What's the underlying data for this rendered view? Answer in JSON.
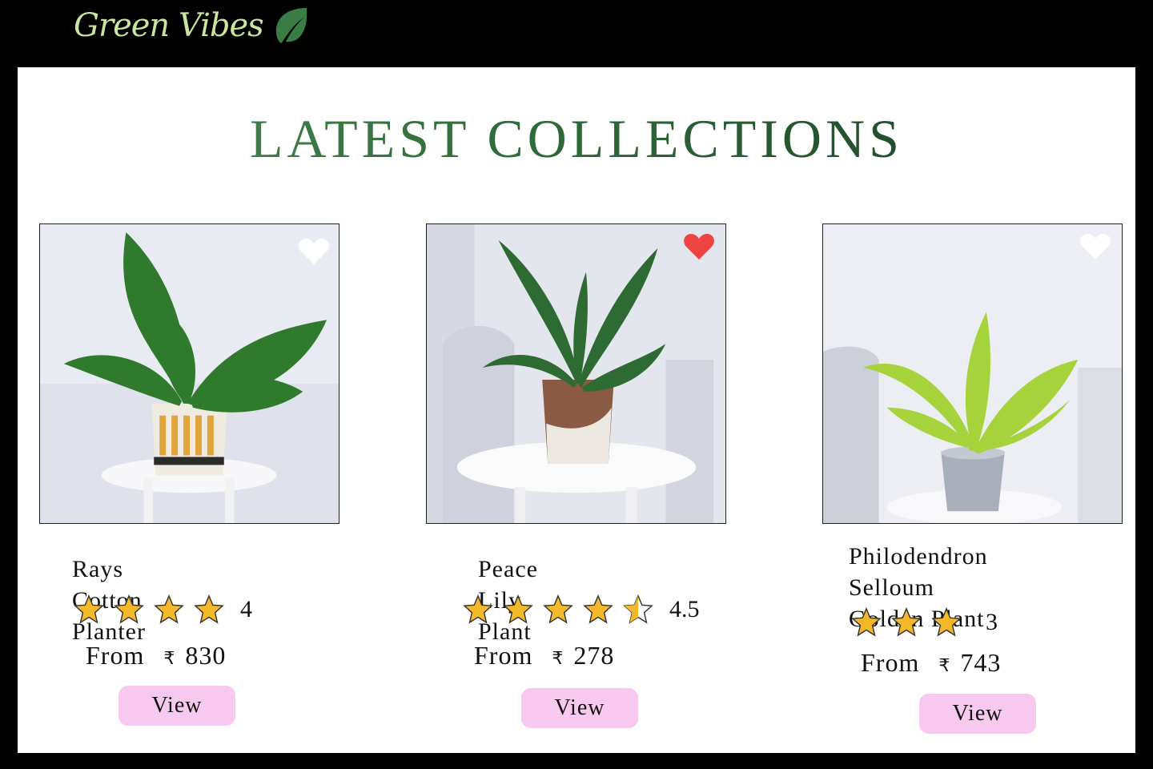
{
  "header": {
    "brand": "Green Vibes",
    "logo_icon": "leaf-icon"
  },
  "section": {
    "title": "LATEST COLLECTIONS"
  },
  "colors": {
    "favorite_active": "#f04444",
    "favorite_inactive": "#ffffff",
    "star": "#f5b829",
    "button": "#f7c9ee",
    "brand_text": "#c8e6a0"
  },
  "products": [
    {
      "name": "Rays Cotton Planter",
      "rating": "4",
      "rating_value": 4,
      "price_label": "From",
      "currency": "₹",
      "price": "830",
      "button_label": "View",
      "favorited": false
    },
    {
      "name": "Peace Lily Plant",
      "rating": "4.5",
      "rating_value": 4.5,
      "price_label": "From",
      "currency": "₹",
      "price": "278",
      "button_label": "View",
      "favorited": true
    },
    {
      "name_line1": "Philodendron Selloum",
      "name_line2": "Golden Plant",
      "rating": "3",
      "rating_value": 3,
      "price_label": "From",
      "currency": "₹",
      "price": "743",
      "button_label": "View",
      "favorited": false
    }
  ]
}
